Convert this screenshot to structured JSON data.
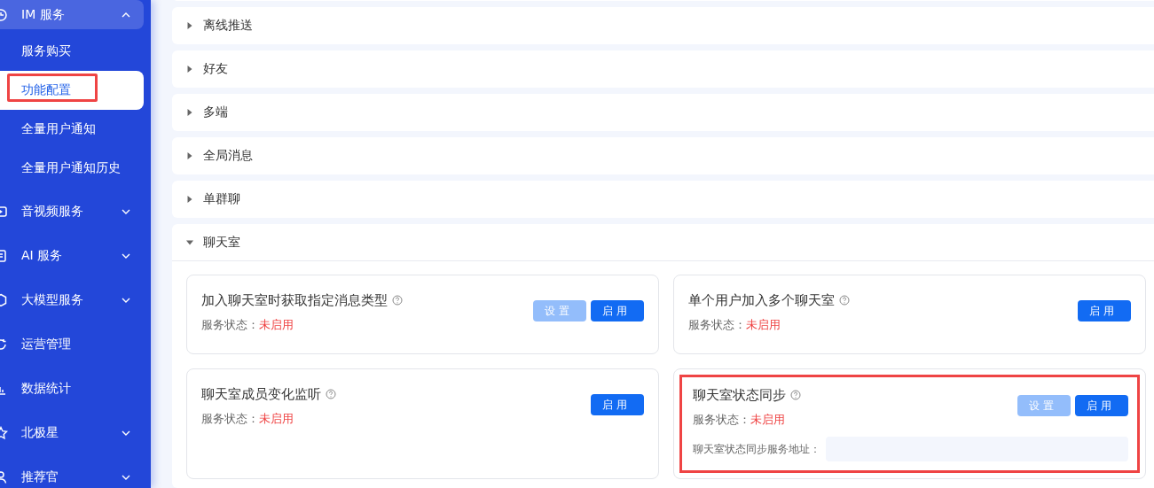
{
  "sidebar": {
    "groups": [
      {
        "label": "IM 服务",
        "expanded": true,
        "children": [
          {
            "label": "服务购买",
            "selected": false,
            "highlighted": false
          },
          {
            "label": "功能配置",
            "selected": true,
            "highlighted": true
          },
          {
            "label": "全量用户通知",
            "selected": false,
            "highlighted": false
          },
          {
            "label": "全量用户通知历史",
            "selected": false,
            "highlighted": false
          }
        ]
      },
      {
        "label": "音视频服务",
        "expanded": false
      },
      {
        "label": "AI 服务",
        "expanded": false
      },
      {
        "label": "大模型服务",
        "expanded": false
      },
      {
        "label": "运营管理"
      },
      {
        "label": "数据统计"
      },
      {
        "label": "北极星",
        "expanded": false
      },
      {
        "label": "推荐官",
        "expanded": false
      }
    ]
  },
  "sections": [
    {
      "title": "离线推送",
      "expanded": false
    },
    {
      "title": "好友",
      "expanded": false
    },
    {
      "title": "多端",
      "expanded": false
    },
    {
      "title": "全局消息",
      "expanded": false
    },
    {
      "title": "单群聊",
      "expanded": false
    },
    {
      "title": "聊天室",
      "expanded": true,
      "cards": [
        {
          "title": "加入聊天室时获取指定消息类型",
          "status_label": "服务状态：",
          "status": "未启用",
          "enabled": false,
          "highlighted": false,
          "buttons": [
            {
              "label": "设置",
              "disabled": true
            },
            {
              "label": "启用",
              "disabled": false
            }
          ]
        },
        {
          "title": "单个用户加入多个聊天室",
          "status_label": "服务状态：",
          "status": "未启用",
          "enabled": false,
          "highlighted": false,
          "buttons": [
            {
              "label": "启用",
              "disabled": false
            }
          ]
        },
        {
          "title": "聊天室成员变化监听",
          "status_label": "服务状态：",
          "status": "未启用",
          "enabled": false,
          "highlighted": false,
          "buttons": [
            {
              "label": "启用",
              "disabled": false
            }
          ]
        },
        {
          "title": "聊天室状态同步",
          "status_label": "服务状态：",
          "status": "未启用",
          "enabled": false,
          "highlighted": true,
          "buttons": [
            {
              "label": "设置",
              "disabled": true
            },
            {
              "label": "启用",
              "disabled": false
            }
          ],
          "field": {
            "label": "聊天室状态同步服务地址："
          }
        }
      ]
    }
  ]
}
